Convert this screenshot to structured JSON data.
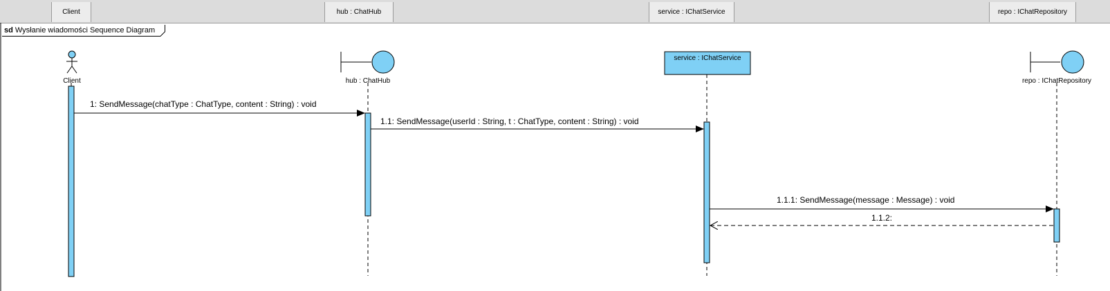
{
  "header": {
    "cells": [
      "Client",
      "hub : ChatHub",
      "service : IChatService",
      "repo : IChatRepository"
    ]
  },
  "frame": {
    "keyword": "sd",
    "title": "Wysłanie wiadomości Sequence Diagram"
  },
  "lifelines": {
    "client": "Client",
    "hub": "hub : ChatHub",
    "service": "service : IChatService",
    "repo": "repo : IChatRepository"
  },
  "messages": {
    "m1": "1: SendMessage(chatType : ChatType, content : String) : void",
    "m11": "1.1: SendMessage(userId : String, t : ChatType, content : String) : void",
    "m111": "1.1.1: SendMessage(message : Message) : void",
    "m112": "1.1.2:"
  },
  "colors": {
    "accent": "#7fd0f5",
    "header_bg": "#dcdcdc",
    "line": "#000000"
  }
}
